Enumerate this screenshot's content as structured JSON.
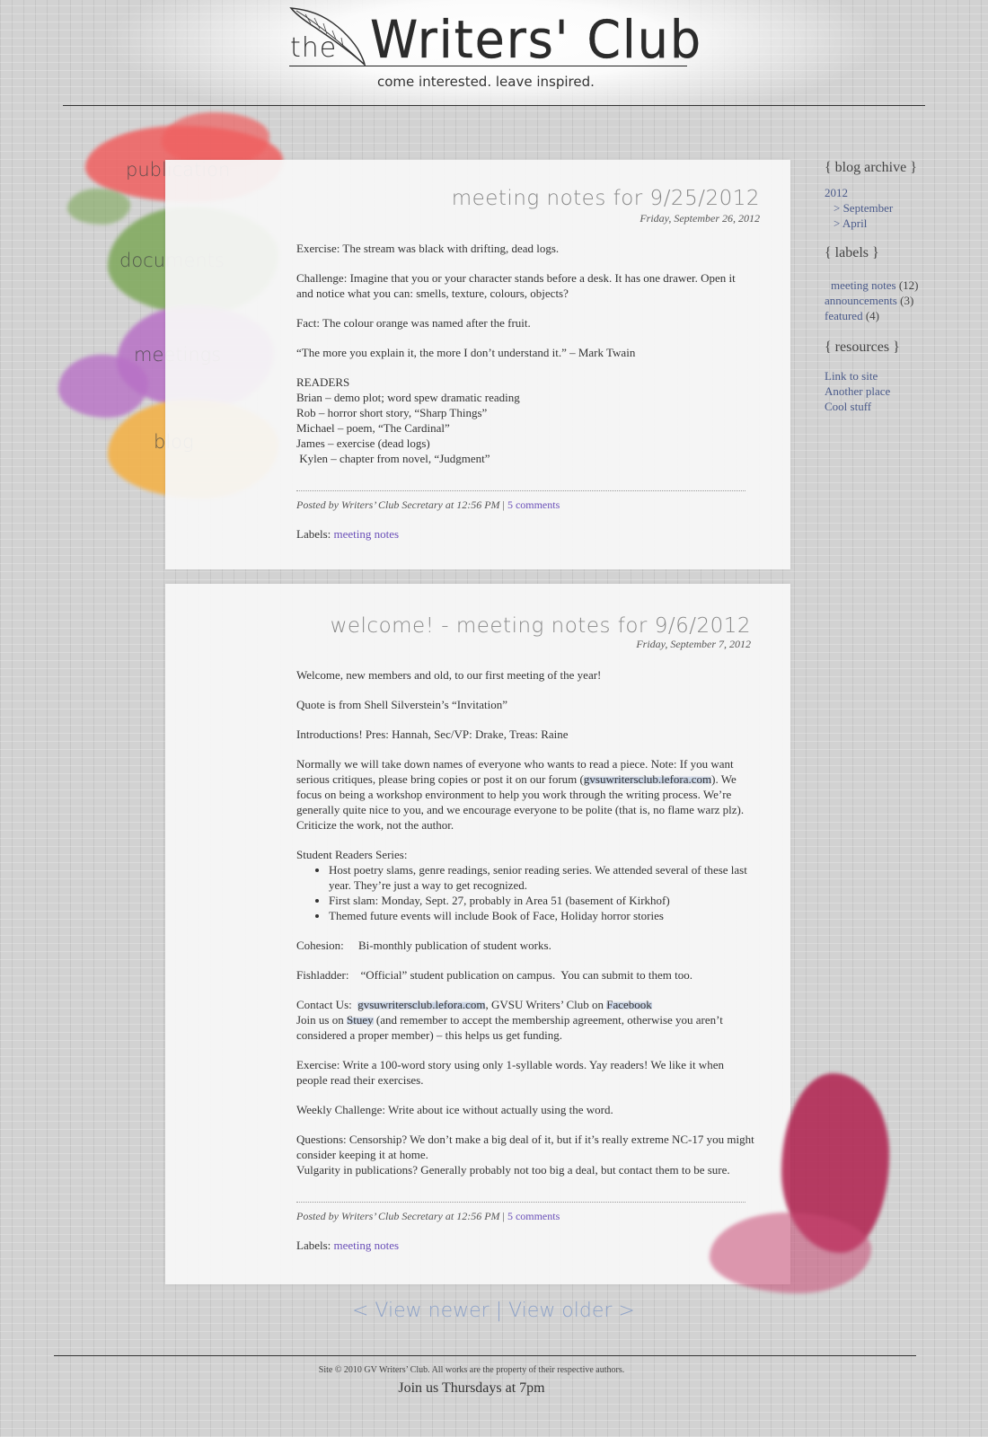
{
  "header": {
    "logo_the": "the",
    "logo_title": "Writers' Club",
    "tagline": "come interested. leave inspired."
  },
  "nav": {
    "items": [
      {
        "label": "publication",
        "color": "#f06060"
      },
      {
        "label": "documents",
        "color": "#7ea85a"
      },
      {
        "label": "meetings",
        "color": "#b871c6"
      },
      {
        "label": "blog",
        "color": "#f3b24a"
      }
    ]
  },
  "posts": [
    {
      "title": "meeting notes for 9/25/2012",
      "date": "Friday, September 26, 2012",
      "p1": "Exercise: The stream was black with drifting, dead logs.",
      "p2": "Challenge: Imagine that you or your character stands before a desk.  It has one drawer.  Open it and notice what you can: smells, texture, colours, objects?",
      "p3": "Fact: The colour orange was named after the fruit.",
      "p4": "“The more you explain it, the more I don’t understand it.” –  Mark Twain",
      "readers_heading": "READERS",
      "readers": [
        "Brian –  demo plot; word spew dramatic reading",
        "Rob –  horror short story, “Sharp Things”",
        "Michael – poem, “The Cardinal”",
        "James – exercise (dead logs)",
        " Kylen – chapter from novel, “Judgment”"
      ],
      "posted_by": "Posted by Writers’ Club Secretary at 12:56 PM",
      "divider": "|",
      "comments": "5 comments",
      "labels_prefix": "Labels:",
      "label": "meeting notes"
    },
    {
      "title": "welcome! - meeting notes for 9/6/2012",
      "date": "Friday, September 7, 2012",
      "p1": "Welcome, new members and old, to our first meeting of the year!",
      "p2": "Quote is from Shell Silverstein’s “Invitation”",
      "p3": "Introductions!  Pres: Hannah, Sec/VP: Drake, Treas: Raine",
      "p4a": "Normally we will take down names of everyone who wants to read a piece.  Note:  If you want serious critiques, please bring copies or post it on our forum (",
      "p4_link": "gvsuwritersclub.lefora.com",
      "p4b": ").  We focus on being a workshop environment to help you work through the writing process.  We’re generally quite nice to you, and we encourage everyone to be polite (that is, no flame warz plz).  Criticize the work, not the author.",
      "series_heading": "Student Readers Series:",
      "bullet1": "Host poetry slams, genre readings, senior reading series.  We attended several of these last year.  They’re just a way to get recognized.",
      "bullet2": "First slam: Monday, Sept. 27, probably in Area 51 (basement of Kirkhof)",
      "bullet3": "Themed future events will include Book of Face, Holiday horror stories",
      "cohesion": "Cohesion:     Bi-monthly publication of student works.",
      "fishladder": "Fishladder:    “Official” student publication on campus.  You can submit to them too.",
      "contact_prefix": "Contact Us:  ",
      "contact_link1": "gvsuwritersclub.lefora.com",
      "contact_mid": ", GVSU Writers’ Club on ",
      "contact_link2": "Facebook",
      "join_prefix": "Join us on ",
      "join_link": "Stuey",
      "join_rest": " (and remember to accept the membership agreement, otherwise you aren’t considered a proper member) – this helps us get funding.",
      "exercise": "Exercise:  Write a 100-word story using only 1-syllable words.  Yay readers!  We like it when people read their exercises.",
      "challenge": "Weekly Challenge:  Write about ice without actually using the word.",
      "questions1": "Questions:  Censorship?  We don’t make a big deal of it, but if it’s really extreme NC-17 you might consider keeping it at home.",
      "questions2": "Vulgarity in publications?  Generally probably not too big a deal, but contact them to be sure.",
      "posted_by": "Posted by Writers’ Club Secretary at 12:56 PM",
      "divider": "|",
      "comments": "5 comments",
      "labels_prefix": "Labels:",
      "label": "meeting notes"
    }
  ],
  "sidebar": {
    "archive_heading": "{ blog archive }",
    "year": "2012",
    "months": [
      "> September",
      "> April"
    ],
    "labels_heading": "{ labels }",
    "labels": [
      {
        "name": "meeting notes",
        "count": "(12)"
      },
      {
        "name": "announcements",
        "count": "(3)"
      },
      {
        "name": "featured",
        "count": "(4)"
      }
    ],
    "resources_heading": "{ resources }",
    "resources": [
      "Link to site",
      "Another place",
      "Cool stuff"
    ]
  },
  "pager": {
    "newer": "< View newer",
    "sep": "|",
    "older": "View older >"
  },
  "footer": {
    "copyright": "Site © 2010 GV Writers’ Club. All works are the property of their respective authors.",
    "join": "Join us Thursdays at 7pm"
  }
}
